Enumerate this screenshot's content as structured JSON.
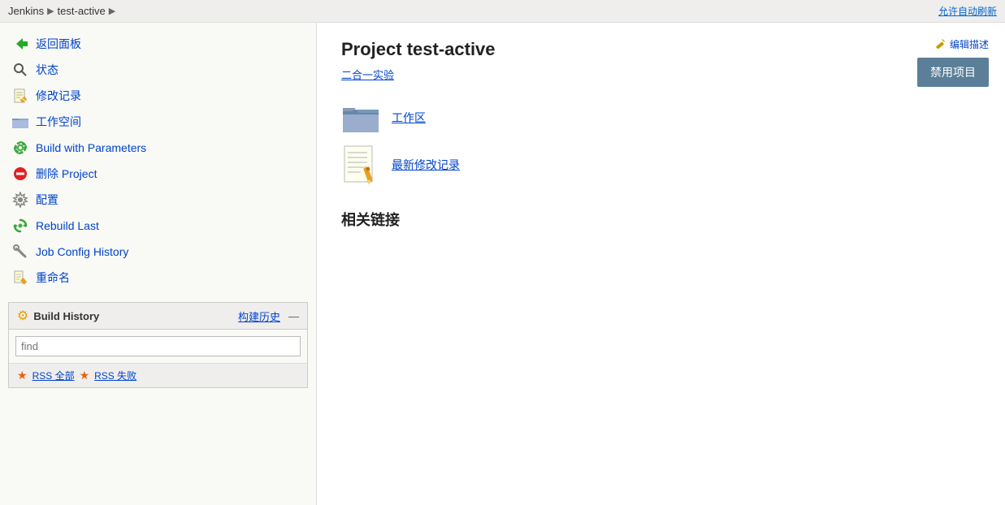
{
  "breadcrumb": {
    "jenkins": "Jenkins",
    "sep1": "▶",
    "project": "test-active",
    "sep2": "▶",
    "auto_refresh": "允许自动刷新"
  },
  "sidebar": {
    "items": [
      {
        "id": "back",
        "label": "返回面板",
        "icon": "back-arrow-icon"
      },
      {
        "id": "status",
        "label": "状态",
        "icon": "magnifier-icon"
      },
      {
        "id": "changes",
        "label": "修改记录",
        "icon": "edit-doc-icon"
      },
      {
        "id": "workspace",
        "label": "工作空间",
        "icon": "folder-icon"
      },
      {
        "id": "build-params",
        "label": "Build with Parameters",
        "icon": "gear-green-icon"
      },
      {
        "id": "delete",
        "label": "删除 Project",
        "icon": "no-icon"
      },
      {
        "id": "configure",
        "label": "配置",
        "icon": "gear-gray-icon"
      },
      {
        "id": "rebuild",
        "label": "Rebuild Last",
        "icon": "gear-green2-icon"
      },
      {
        "id": "job-config",
        "label": "Job Config History",
        "icon": "wrench-icon"
      },
      {
        "id": "rename",
        "label": "重命名",
        "icon": "pencil-doc-icon"
      }
    ]
  },
  "build_history": {
    "title": "Build History",
    "link_label": "构建历史",
    "dash": "—",
    "search_placeholder": "find",
    "rss_all_label": "RSS 全部",
    "rss_fail_label": "RSS 失败"
  },
  "main": {
    "project_title": "Project test-active",
    "subtitle": "二合一实验",
    "edit_description_label": "编辑描述",
    "disable_button_label": "禁用项目",
    "workspace_link": "工作区",
    "changelog_link": "最新修改记录",
    "related_links_title": "相关链接"
  }
}
